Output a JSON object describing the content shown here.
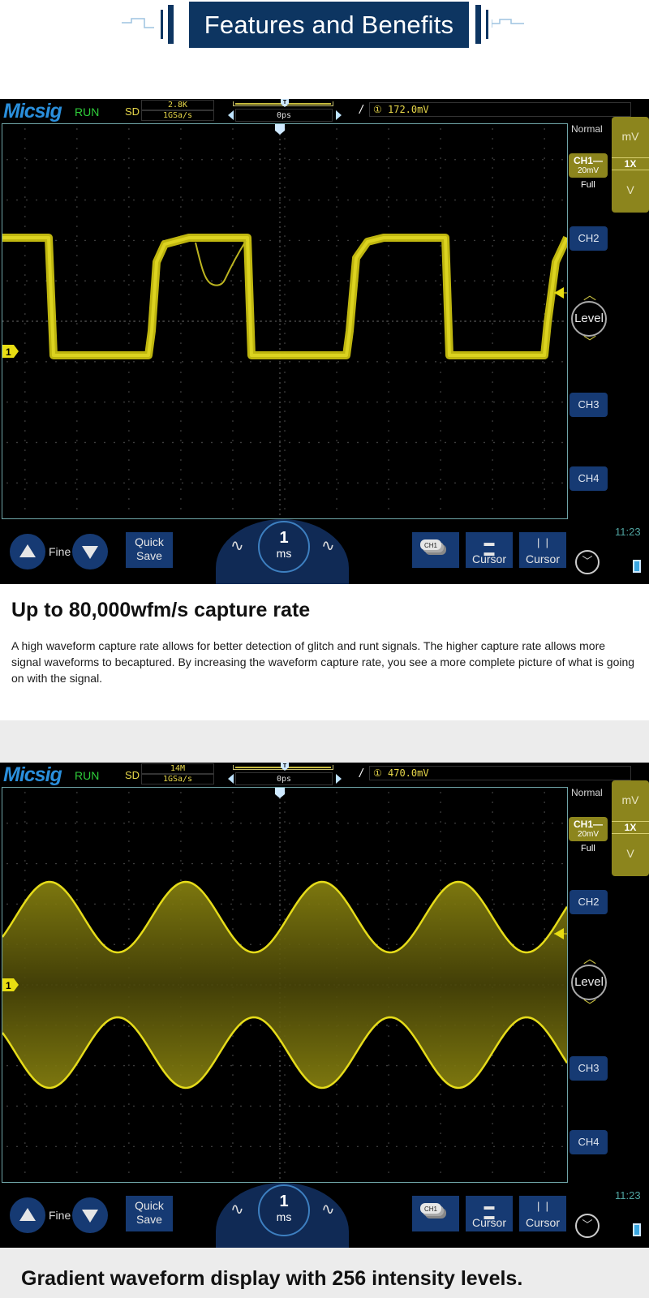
{
  "banner": {
    "title": "Features and Benefits"
  },
  "colors": {
    "banner_bg": "#0d3561",
    "trace": "#d8cf14",
    "ch1": "#8c851d",
    "button": "#163a73",
    "grid_border": "#6fa5a8",
    "section_gray": "#ececec"
  },
  "scopes": [
    {
      "logo": "Micsig",
      "run_state": "RUN",
      "mode": "SD",
      "memory_depth": "2.8K",
      "sample_rate": "1GSa/s",
      "trigger_position": "0ps",
      "trigger_marker": "T",
      "trigger_source_icon": "①",
      "trigger_level": "172.0mV",
      "trigger_mode": "Normal",
      "volt_units": {
        "up": "mV",
        "probe": "1X",
        "down": "V"
      },
      "ch1": {
        "label": "CH1",
        "scale": "20mV",
        "bandwidth": "Full"
      },
      "channels": [
        "CH2",
        "CH3",
        "CH4"
      ],
      "level_label": "Level",
      "ch1_marker": "1",
      "bottom": {
        "fine": "Fine",
        "quick_save": [
          "Quick",
          "Save"
        ],
        "timebase_value": "1",
        "timebase_unit": "ms",
        "ch1_stack": "CH1",
        "cursor_h": "Cursor",
        "cursor_v": "Cursor",
        "time": "11:23"
      },
      "waveform": "square wave with runt glitch"
    },
    {
      "logo": "Micsig",
      "run_state": "RUN",
      "mode": "SD",
      "memory_depth": "14M",
      "sample_rate": "1GSa/s",
      "trigger_position": "0ps",
      "trigger_marker": "T",
      "trigger_source_icon": "①",
      "trigger_level": "470.0mV",
      "trigger_mode": "Normal",
      "volt_units": {
        "up": "mV",
        "probe": "1X",
        "down": "V"
      },
      "ch1": {
        "label": "CH1",
        "scale": "20mV",
        "bandwidth": "Full"
      },
      "channels": [
        "CH2",
        "CH3",
        "CH4"
      ],
      "level_label": "Level",
      "ch1_marker": "1",
      "bottom": {
        "fine": "Fine",
        "quick_save": [
          "Quick",
          "Save"
        ],
        "timebase_value": "1",
        "timebase_unit": "ms",
        "ch1_stack": "CH1",
        "cursor_h": "Cursor",
        "cursor_v": "Cursor",
        "time": "11:23"
      },
      "waveform": "amplitude-modulated gradient envelope"
    }
  ],
  "section1": {
    "heading": "Up to 80,000wfm/s capture rate",
    "paragraph": "A high waveform capture rate allows for better detection of glitch and runt signals.  The higher capture rate allows more signal waveforms to becaptured. By increasing the waveform capture rate, you see a more complete picture of what is going on with the signal."
  },
  "section2": {
    "heading": "Gradient waveform display with 256 intensity levels."
  }
}
